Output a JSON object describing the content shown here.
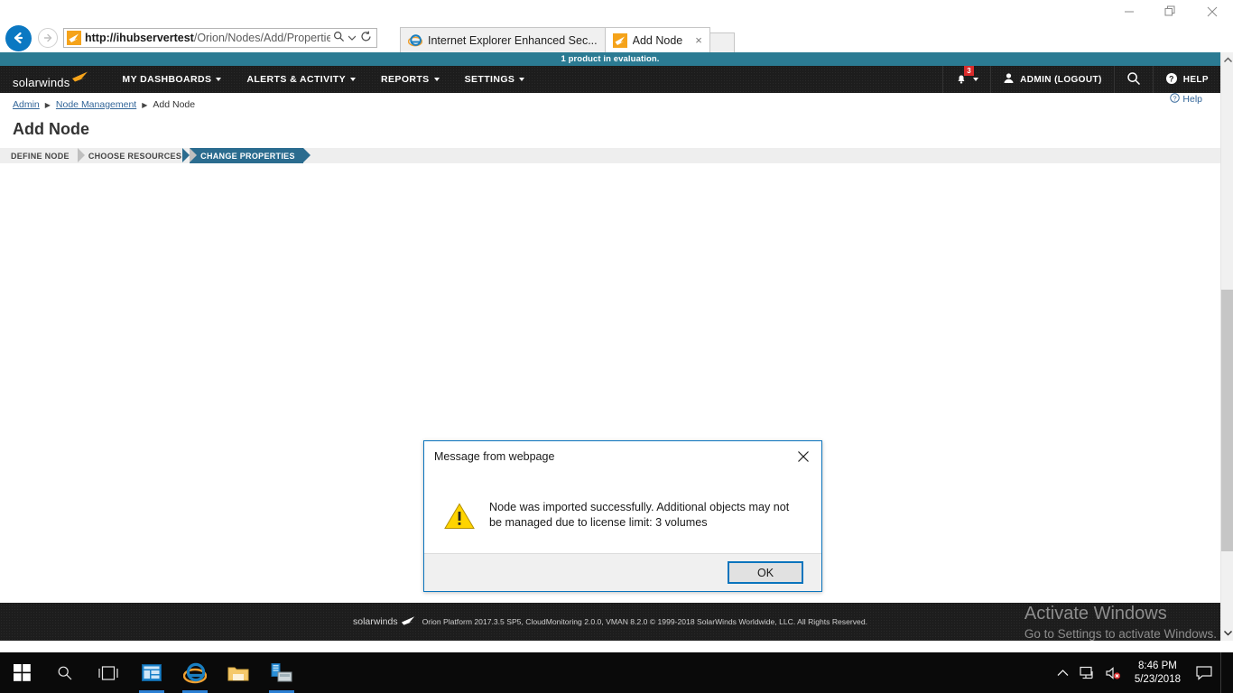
{
  "browser": {
    "window_controls": {
      "minimize": "minimize-button",
      "restore": "restore-button",
      "close": "close-button"
    },
    "address": {
      "url_host": "http://ihubservertest",
      "url_path": "/Orion/Nodes/Add/Properties.as",
      "search_icon": "search-icon",
      "refresh_icon": "refresh-icon"
    },
    "tabs": [
      {
        "label": "Internet Explorer Enhanced Sec...",
        "active": false,
        "icon": "internet-explorer-icon"
      },
      {
        "label": "Add Node",
        "active": true,
        "icon": "solarwinds-favicon"
      }
    ],
    "tab_close_label": "×",
    "toolbar_icons": [
      "home-icon",
      "favorites-star-icon",
      "tools-gear-icon",
      "smiley-feedback-icon"
    ]
  },
  "eval_banner": {
    "text": "1 product in evaluation."
  },
  "topnav": {
    "logo_text": "solarwinds",
    "items": [
      {
        "label": "MY DASHBOARDS",
        "has_caret": true
      },
      {
        "label": "ALERTS & ACTIVITY",
        "has_caret": true
      },
      {
        "label": "REPORTS",
        "has_caret": true
      },
      {
        "label": "SETTINGS",
        "has_caret": true
      }
    ],
    "alerts": {
      "icon": "alert-bell-icon",
      "badge": "3"
    },
    "user": {
      "icon": "user-icon",
      "label": "ADMIN (LOGOUT)"
    },
    "search_icon": "search-icon",
    "help": {
      "icon": "help-question-icon",
      "label": "HELP"
    }
  },
  "breadcrumb": {
    "items": [
      {
        "label": "Admin",
        "link": true
      },
      {
        "label": "Node Management",
        "link": true
      },
      {
        "label": "Add Node",
        "link": false
      }
    ],
    "separator": "▶"
  },
  "page_help_link": {
    "label": "Help",
    "icon": "help-question-icon"
  },
  "page": {
    "title": "Add Node",
    "wizard_steps": [
      {
        "label": "DEFINE NODE",
        "active": false
      },
      {
        "label": "CHOOSE RESOURCES",
        "active": false
      },
      {
        "label": "CHANGE PROPERTIES",
        "active": true
      }
    ]
  },
  "modal": {
    "title": "Message from webpage",
    "close_label": "✕",
    "icon": "warning-triangle-icon",
    "message": "Node was imported successfully. Additional objects may not be managed due to license limit: 3 volumes",
    "ok_label": "OK"
  },
  "footer": {
    "logo_text": "solarwinds",
    "text": "Orion Platform 2017.3.5 SP5, CloudMonitoring 2.0.0, VMAN 8.2.0 © 1999-2018 SolarWinds Worldwide, LLC. All Rights Reserved."
  },
  "watermark": {
    "line1": "Activate Windows",
    "line2": "Go to Settings to activate Windows."
  },
  "taskbar": {
    "start": "windows-start-icon",
    "search": "search-icon",
    "taskview": "task-view-icon",
    "pinned": [
      {
        "name": "windows-app-icon",
        "running": true
      },
      {
        "name": "internet-explorer-icon",
        "running": true
      },
      {
        "name": "file-explorer-icon",
        "running": false
      },
      {
        "name": "server-app-icon",
        "running": true
      }
    ],
    "tray": {
      "chevron": "show-hidden-icons-chevron",
      "network": "network-icon",
      "volume": "volume-muted-icon",
      "time": "8:46 PM",
      "date": "5/23/2018",
      "action_center": "action-center-icon"
    }
  },
  "colors": {
    "eval_banner_bg": "#2b7b93",
    "nav_bg": "#1d1d1d",
    "wizard_active": "#2b6c8f",
    "modal_border": "#0a74bd",
    "badge_red": "#d92b2b",
    "link_blue": "#336699"
  },
  "scrollbar": {
    "up_arrow": "scroll-up-arrow",
    "down_arrow": "scroll-down-arrow"
  }
}
